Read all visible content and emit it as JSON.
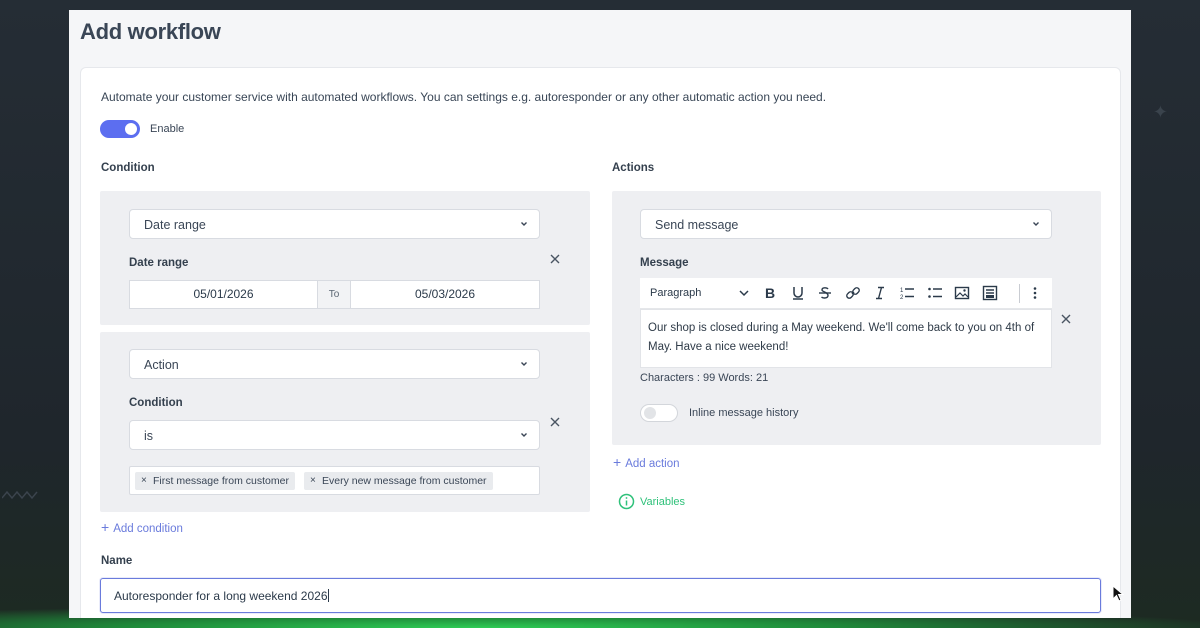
{
  "page": {
    "title": "Add workflow",
    "description": "Automate your customer service with automated workflows. You can settings e.g. autoresponder or any other automatic action you need."
  },
  "enable": {
    "label": "Enable",
    "on": true
  },
  "condition": {
    "heading": "Condition",
    "blocks": [
      {
        "type_value": "Date range",
        "field_label": "Date range",
        "date_from": "05/01/2026",
        "to_label": "To",
        "date_to": "05/03/2026"
      },
      {
        "type_value": "Action",
        "field_label": "Condition",
        "operator_value": "is",
        "tags": [
          "First message from customer",
          "Every new message from customer"
        ]
      }
    ],
    "add_label": "Add condition"
  },
  "actions": {
    "heading": "Actions",
    "type_value": "Send message",
    "message_label": "Message",
    "toolbar": {
      "paragraph": "Paragraph",
      "buttons": [
        "bold-icon",
        "underline-icon",
        "strikethrough-icon",
        "link-icon",
        "italic-icon",
        "numbered-list-icon",
        "bullet-list-icon",
        "image-icon",
        "media-icon",
        "more-icon"
      ]
    },
    "message_text": "Our shop is closed during a May weekend. We'll come back to you on 4th of May. Have a nice weekend!",
    "counter": "Characters : 99 Words: 21",
    "inline_history_label": "Inline message history",
    "inline_history_on": false,
    "add_label": "Add action",
    "variables_label": "Variables"
  },
  "name": {
    "label": "Name",
    "value": "Autoresponder for a long weekend 2026"
  },
  "colors": {
    "accent": "#5c6ef0",
    "link": "#6a7bdc",
    "variables": "#2fc17a",
    "panel": "#eeeff2"
  }
}
